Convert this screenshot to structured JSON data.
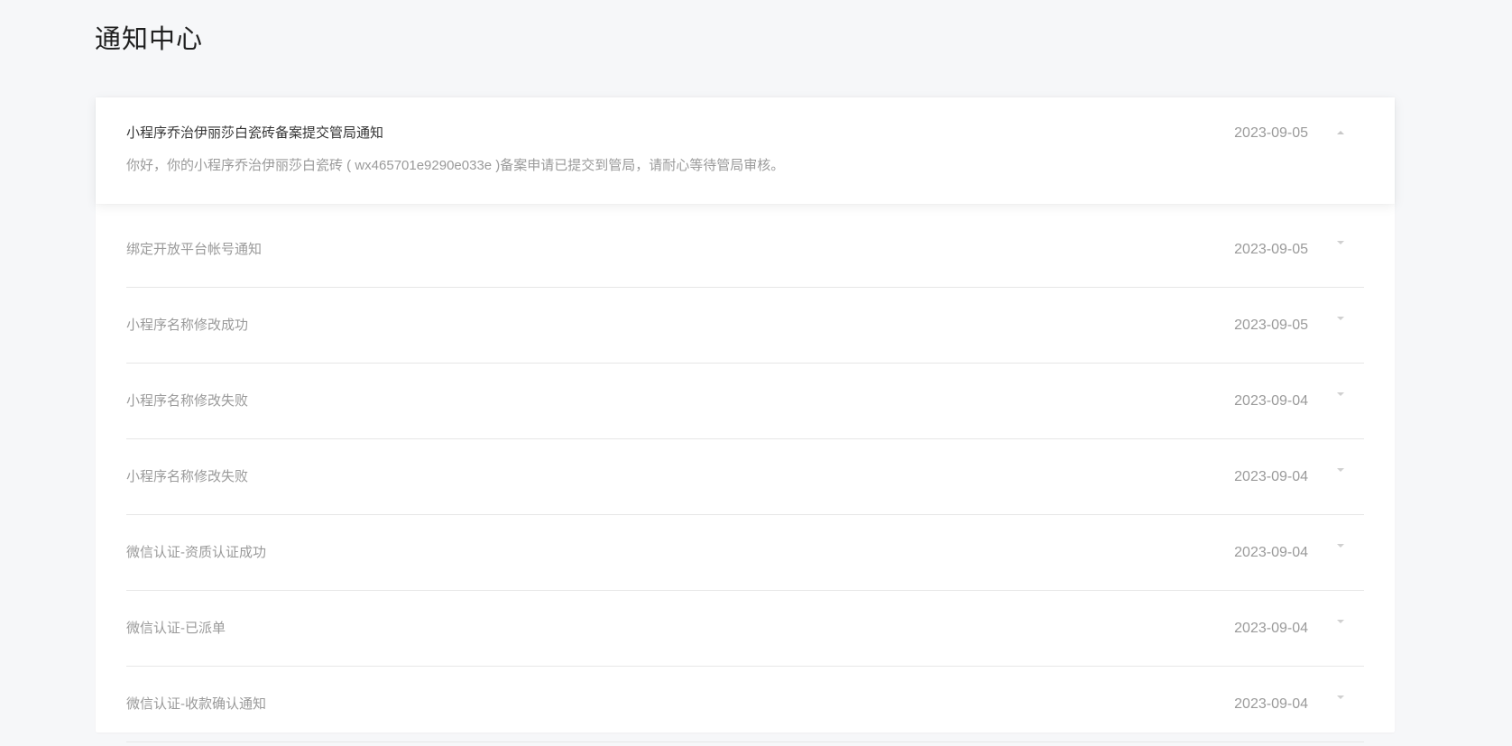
{
  "page": {
    "title": "通知中心"
  },
  "expanded": {
    "title": "小程序乔治伊丽莎白瓷砖备案提交管局通知",
    "date": "2023-09-05",
    "content": "你好，你的小程序乔治伊丽莎白瓷砖 ( wx465701e9290e033e )备案申请已提交到管局，请耐心等待管局审核。"
  },
  "notifications": [
    {
      "title": "绑定开放平台帐号通知",
      "date": "2023-09-05"
    },
    {
      "title": "小程序名称修改成功",
      "date": "2023-09-05"
    },
    {
      "title": "小程序名称修改失败",
      "date": "2023-09-04"
    },
    {
      "title": "小程序名称修改失败",
      "date": "2023-09-04"
    },
    {
      "title": "微信认证-资质认证成功",
      "date": "2023-09-04"
    },
    {
      "title": "微信认证-已派单",
      "date": "2023-09-04"
    },
    {
      "title": "微信认证-收款确认通知",
      "date": "2023-09-04"
    }
  ],
  "icons": {
    "collapse": "chevron-up-icon",
    "expand": "chevron-down-icon"
  },
  "colors": {
    "background": "#f6f7f9",
    "card": "#ffffff",
    "title_text": "#353535",
    "muted_text": "#9a9a9a",
    "divider": "#e7e7e7"
  }
}
